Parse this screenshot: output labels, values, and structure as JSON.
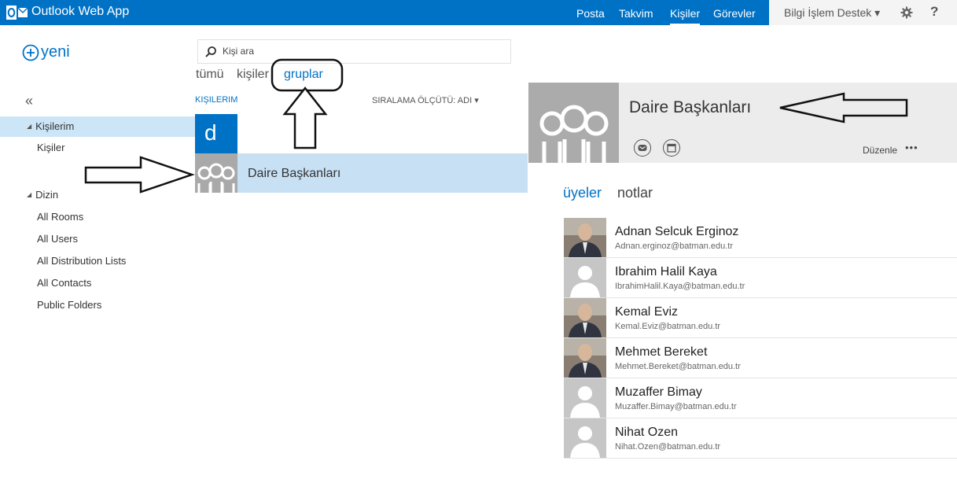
{
  "app": {
    "title": "Outlook Web App"
  },
  "nav": [
    {
      "label": "Posta",
      "selected": false
    },
    {
      "label": "Takvim",
      "selected": false
    },
    {
      "label": "Kişiler",
      "selected": true
    },
    {
      "label": "Görevler",
      "selected": false
    }
  ],
  "user": {
    "name": "Bilgi İşlem Destek ▾",
    "settings_icon": "gear-icon",
    "help": "?"
  },
  "left_pane": {
    "new_label": "yeni",
    "collapse": "«",
    "my_contacts_header": "Kişilerim",
    "my_contacts_items": [
      "Kişiler"
    ],
    "directory_header": "Dizin",
    "directory_items": [
      "All Rooms",
      "All Users",
      "All Distribution Lists",
      "All Contacts",
      "Public Folders"
    ]
  },
  "middle_pane": {
    "search_placeholder": "Kişi ara",
    "filters": [
      {
        "label": "tümü",
        "selected": false
      },
      {
        "label": "kişiler",
        "selected": false
      },
      {
        "label": "gruplar",
        "selected": true
      }
    ],
    "list_header": "KIŞILERIM",
    "sort_label": "SIRALAMA ÖLÇÜTÜ: ADI ▾",
    "letter": "d",
    "group_name": "Daire Başkanları"
  },
  "right_pane": {
    "title": "Daire Başkanları",
    "actions": {
      "mail_icon": "mail-icon",
      "calendar_icon": "calendar-icon",
      "edit": "Düzenle",
      "more": "•••"
    },
    "tabs": [
      {
        "label": "üyeler",
        "selected": true
      },
      {
        "label": "notlar",
        "selected": false
      }
    ],
    "members": [
      {
        "name": "Adnan Selcuk Erginoz",
        "email": "Adnan.erginoz@batman.edu.tr",
        "photo": true
      },
      {
        "name": "Ibrahim Halil Kaya",
        "email": "IbrahimHalil.Kaya@batman.edu.tr",
        "photo": false
      },
      {
        "name": "Kemal Eviz",
        "email": "Kemal.Eviz@batman.edu.tr",
        "photo": true
      },
      {
        "name": "Mehmet Bereket",
        "email": "Mehmet.Bereket@batman.edu.tr",
        "photo": true
      },
      {
        "name": "Muzaffer Bimay",
        "email": "Muzaffer.Bimay@batman.edu.tr",
        "photo": false
      },
      {
        "name": "Nihat Ozen",
        "email": "Nihat.Ozen@batman.edu.tr",
        "photo": false
      }
    ]
  },
  "colors": {
    "brand": "#0072C6",
    "selection": "#C7E0F4",
    "header_bg": "#ECECEC"
  }
}
